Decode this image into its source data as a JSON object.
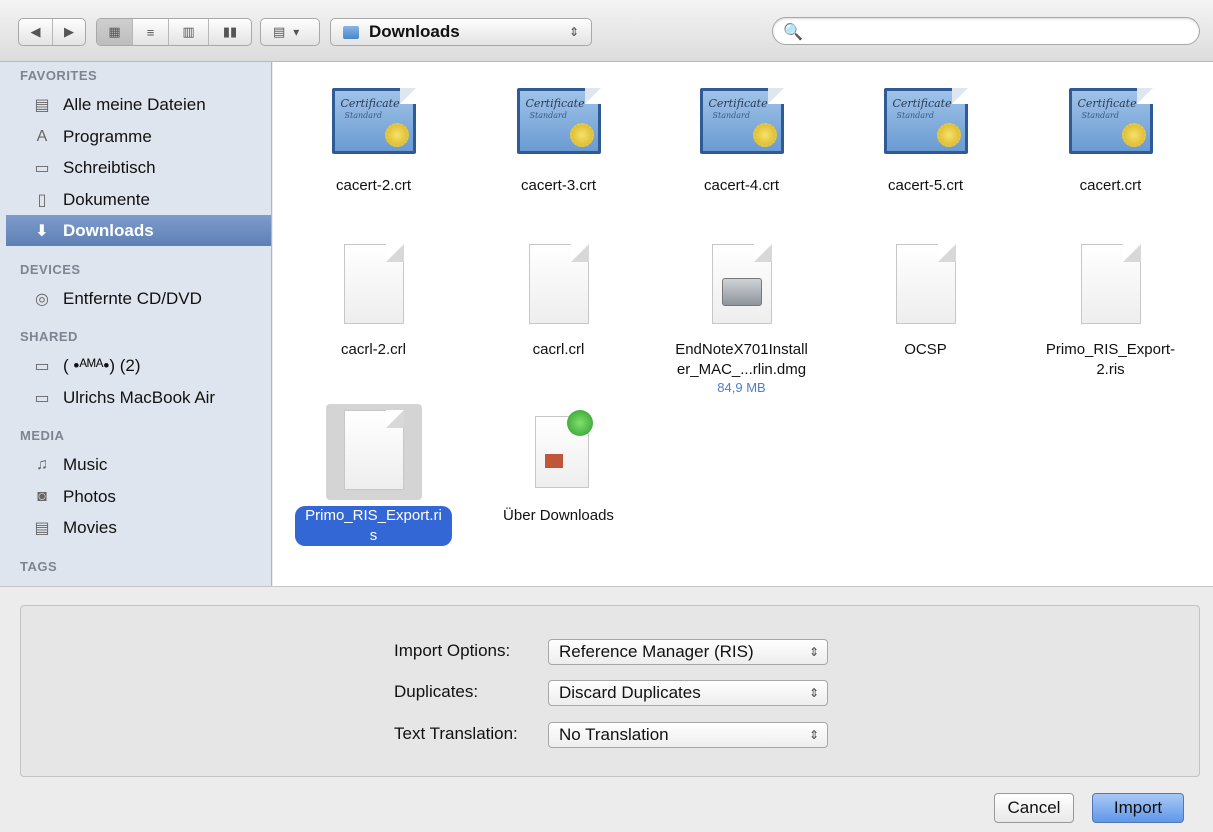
{
  "toolbar": {
    "back_icon": "◀",
    "forward_icon": "▶",
    "view_icons": [
      "▦",
      "≡",
      "▥",
      "▮▮"
    ],
    "arrange_icon": "▤",
    "arrange_caret": "▾",
    "location": "Downloads",
    "location_arrows": "⇕",
    "search_icon": "🔍",
    "search_value": ""
  },
  "sidebar": {
    "sections": [
      {
        "label": "FAVORITES"
      },
      {
        "label": "DEVICES"
      },
      {
        "label": "SHARED"
      },
      {
        "label": "MEDIA"
      },
      {
        "label": "TAGS"
      }
    ],
    "items": [
      {
        "label": "Alle meine Dateien",
        "icon": "▤"
      },
      {
        "label": "Programme",
        "icon": "A"
      },
      {
        "label": "Schreibtisch",
        "icon": "▭"
      },
      {
        "label": "Dokumente",
        "icon": "▯"
      },
      {
        "label": "Downloads",
        "icon": "⬇"
      },
      {
        "label": "Entfernte CD/DVD",
        "icon": "◎"
      },
      {
        "label": "( •ᴬᴹᴬ•) (2)",
        "icon": "▭"
      },
      {
        "label": "Ulrichs MacBook Air",
        "icon": "▭"
      },
      {
        "label": "Music",
        "icon": "♫"
      },
      {
        "label": "Photos",
        "icon": "◙"
      },
      {
        "label": "Movies",
        "icon": "▤"
      }
    ]
  },
  "files": [
    {
      "name": "cacert-2.crt",
      "kind": "cert",
      "size": ""
    },
    {
      "name": "cacert-3.crt",
      "kind": "cert",
      "size": ""
    },
    {
      "name": "cacert-4.crt",
      "kind": "cert",
      "size": ""
    },
    {
      "name": "cacert-5.crt",
      "kind": "cert",
      "size": ""
    },
    {
      "name": "cacert.crt",
      "kind": "cert",
      "size": ""
    },
    {
      "name": "cacrl-2.crl",
      "kind": "doc",
      "size": ""
    },
    {
      "name": "cacrl.crl",
      "kind": "doc",
      "size": ""
    },
    {
      "name": "EndNoteX701Install\ner_MAC_...rlin.dmg",
      "kind": "dmg",
      "size": "84,9 MB"
    },
    {
      "name": "OCSP",
      "kind": "doc",
      "size": ""
    },
    {
      "name": "Primo_RIS_Export-\n2.ris",
      "kind": "doc",
      "size": ""
    },
    {
      "name": "Primo_RIS_Export.ri\ns",
      "kind": "doc",
      "size": ""
    },
    {
      "name": "Über Downloads",
      "kind": "guide",
      "size": ""
    }
  ],
  "cert_text": {
    "line1": "Certificate",
    "line2": "Standard"
  },
  "options": {
    "import_label": "Import Options:",
    "import_value": "Reference Manager (RIS)",
    "duplicates_label": "Duplicates:",
    "duplicates_value": "Discard Duplicates",
    "translation_label": "Text Translation:",
    "translation_value": "No Translation",
    "popup_arrows": "⇕"
  },
  "buttons": {
    "cancel": "Cancel",
    "import": "Import"
  }
}
